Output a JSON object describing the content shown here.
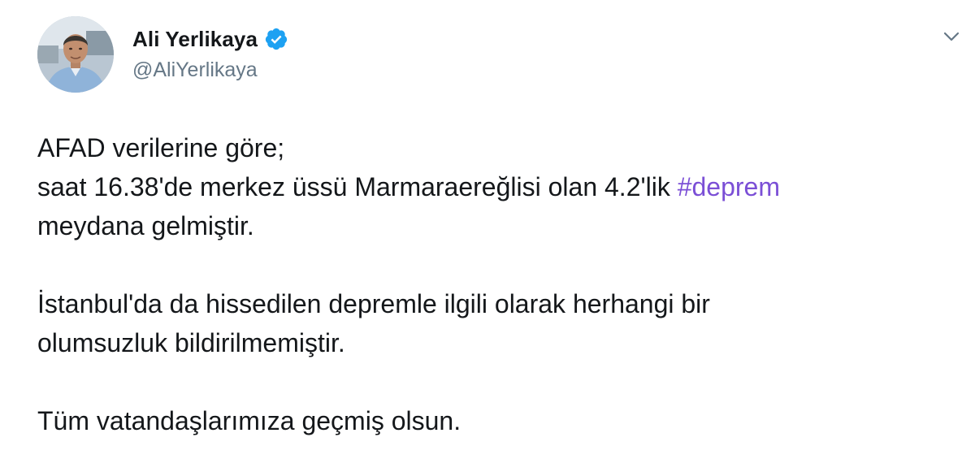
{
  "author": {
    "display_name": "Ali Yerlikaya",
    "handle": "@AliYerlikaya",
    "verified": true,
    "avatar_icon": "profile-photo"
  },
  "menu": {
    "icon": "chevron-down-icon"
  },
  "tweet": {
    "line1": "AFAD verilerine göre;",
    "line2_prefix": "saat 16.38'de merkez üssü Marmaraereğlisi olan 4.2'lik ",
    "hashtag": "#deprem",
    "line3": "meydana gelmiştir.",
    "para2_line1": "İstanbul'da da hissedilen depremle ilgili olarak herhangi bir",
    "para2_line2": "olumsuzluk bildirilmemiştir.",
    "para3": "Tüm vatandaşlarımıza geçmiş olsun."
  },
  "colors": {
    "text": "#14171a",
    "secondary": "#657786",
    "link": "#7b4fd6",
    "verified_badge": "#1da1f2"
  }
}
